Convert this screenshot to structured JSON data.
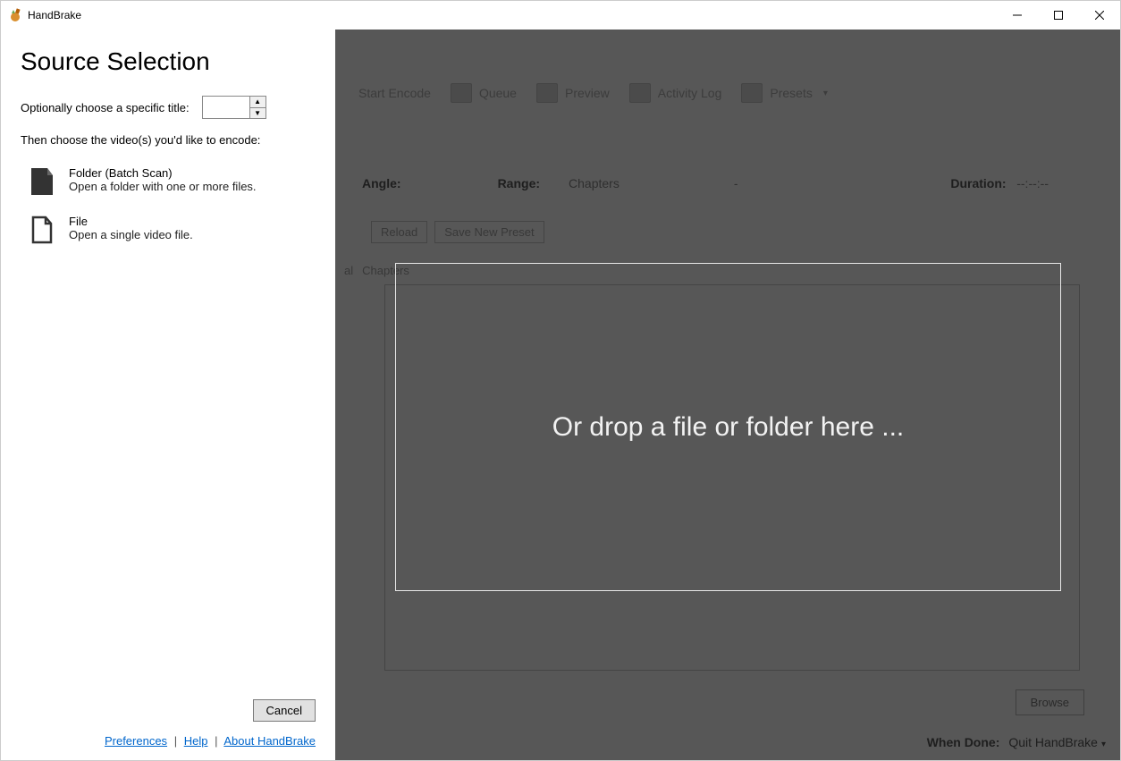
{
  "titlebar": {
    "app_name": "HandBrake"
  },
  "sidebar": {
    "heading": "Source Selection",
    "title_label": "Optionally choose a specific title:",
    "spinner_value": "",
    "instruction": "Then choose the video(s) you'd like to encode:",
    "items": [
      {
        "title": "Folder (Batch Scan)",
        "subtitle": "Open a folder with one or more files."
      },
      {
        "title": "File",
        "subtitle": "Open a single video file."
      }
    ],
    "cancel_label": "Cancel",
    "links": {
      "prefs": "Preferences",
      "help": "Help",
      "about": "About HandBrake"
    }
  },
  "toolbar": {
    "items": [
      "Start Encode",
      "Queue",
      "Preview",
      "Activity Log",
      "Presets"
    ]
  },
  "info": {
    "angle_label": "Angle:",
    "range_label": "Range:",
    "range_value": "Chapters",
    "range_dash": "-",
    "duration_label": "Duration:",
    "duration_value": "--:--:--"
  },
  "chips": {
    "reload": "Reload",
    "save_preset": "Save New Preset"
  },
  "tabs": {
    "audio": "al",
    "chapters": "Chapters"
  },
  "drop": {
    "text": "Or drop a file or folder here ..."
  },
  "browse": {
    "label": "Browse"
  },
  "bottom": {
    "when_done_label": "When Done:",
    "when_done_value": "Quit HandBrake"
  }
}
